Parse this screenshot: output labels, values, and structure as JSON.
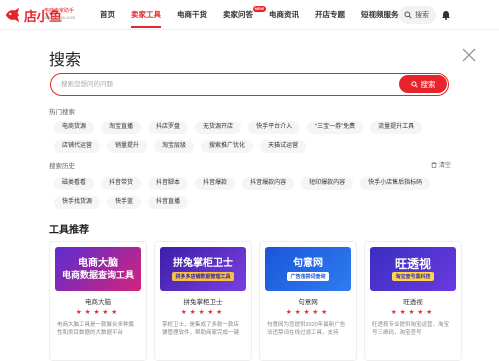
{
  "brand": {
    "logo_text": "店小鱼",
    "tagline": "电商卖家助手",
    "domain": "dianxiaoyu.com",
    "red": "#e8242b"
  },
  "nav": {
    "items": [
      {
        "label": "首页",
        "active": false,
        "badge": ""
      },
      {
        "label": "卖家工具",
        "active": true,
        "badge": ""
      },
      {
        "label": "电商干货",
        "active": false,
        "badge": ""
      },
      {
        "label": "卖家问答",
        "active": false,
        "badge": "NEW"
      },
      {
        "label": "电商资讯",
        "active": false,
        "badge": ""
      },
      {
        "label": "开店专题",
        "active": false,
        "badge": ""
      },
      {
        "label": "短视频服务",
        "active": false,
        "badge": ""
      }
    ],
    "search_label": "搜索",
    "bell_icon": "bell-icon"
  },
  "search": {
    "title": "搜索",
    "placeholder": "搜索您想问的问题",
    "value": "",
    "button_label": "搜索"
  },
  "hot": {
    "label": "热门搜索",
    "tags": [
      "电商货源",
      "淘宝直播",
      "抖店罗盘",
      "无货源开店",
      "快手平台介入",
      "“三宝一券”免费",
      "流量提升工具",
      "店铺代运营",
      "销量提升",
      "淘宝层级",
      "搜索推广优化",
      "天猫试运营"
    ]
  },
  "history": {
    "label": "搜索历史",
    "clear_label": "清空",
    "tags": [
      "磁类看看",
      "抖音带货",
      "抖音脚本",
      "抖音爆款",
      "抖音爆款内容",
      "短印爆款内容",
      "快手小店售后指标码",
      "快手找货源",
      "快手蓝",
      "抖音直播"
    ]
  },
  "tools": {
    "title": "工具推荐",
    "cards": [
      {
        "banner_line1": "电商大脑",
        "banner_line2": "电商数据查询工具",
        "banner_tag": "",
        "name": "电商大脑",
        "stars": "★★★★★",
        "desc": "电商大脑工具是一款聚合多种属性和类目数据的大数据平台",
        "colors": [
          "#5b2dd1",
          "#d4237a"
        ]
      },
      {
        "banner_line1": "拼兔掌柜卫士",
        "banner_line2": "",
        "banner_tag": "拼多多店铺数据管理工具",
        "name": "拼兔掌柜卫士",
        "stars": "★★★★★",
        "desc": "掌柜卫士，是集成了多款一款店铺管理软件，帮助商家完成一键",
        "colors": [
          "#3b1fa8",
          "#7b3fe0"
        ]
      },
      {
        "banner_line1": "句意网",
        "banner_line2": "",
        "banner_tag": "广告违禁词查询",
        "name": "句意网",
        "stars": "★★★★★",
        "desc": "句意网为您提供2020年最新广告法违禁词在线过滤工具，支持",
        "colors": [
          "#1a56d8",
          "#2f7cf0"
        ]
      },
      {
        "banner_line1": "旺透视",
        "banner_line2": "",
        "banner_tag": "淘宝查号黑科技",
        "name": "旺透视",
        "stars": "★★★★★",
        "desc": "旺透视专业提供淘宝运营，淘宝号三维码，淘宝查号",
        "colors": [
          "#3a2ec2",
          "#6a3ae0"
        ]
      }
    ]
  }
}
